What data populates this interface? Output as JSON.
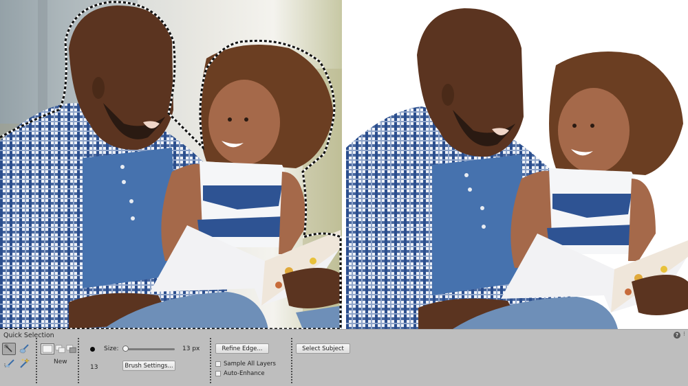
{
  "app": {
    "panel": "Tool Options"
  },
  "canvas": {
    "left_image": {
      "label": "Original photo with active selection (marching ants)",
      "selection_active": true
    },
    "right_image": {
      "label": "Selected subject on white background",
      "background": "#ffffff"
    }
  },
  "options_bar": {
    "tool_title": "Quick Selection",
    "tools": [
      {
        "name": "quick-selection",
        "icon": "quick-selection-icon",
        "active": true
      },
      {
        "name": "selection-brush",
        "icon": "selection-brush-icon",
        "active": false
      },
      {
        "name": "auto-selection",
        "icon": "auto-selection-icon",
        "active": false
      },
      {
        "name": "magic-wand",
        "icon": "magic-wand-icon",
        "active": false
      }
    ],
    "selection_modes": [
      {
        "name": "new",
        "icon": "new-selection-icon",
        "active": true
      },
      {
        "name": "add",
        "icon": "add-to-selection-icon",
        "active": false
      },
      {
        "name": "subtract",
        "icon": "subtract-from-selection-icon",
        "active": false
      }
    ],
    "mode_label": "New",
    "brush": {
      "preview_size": "13",
      "size_label": "Size:",
      "size_value": 13,
      "size_readout": "13 px",
      "size_fraction": 0.02,
      "settings_button": "Brush Settings..."
    },
    "refine_edge_button": "Refine Edge...",
    "sample_all_layers": {
      "label": "Sample All Layers",
      "checked": false
    },
    "auto_enhance": {
      "label": "Auto-Enhance",
      "checked": false
    },
    "select_subject_button": "Select Subject",
    "help_icon": "?",
    "panel_menu_icon": "⁝"
  },
  "colors": {
    "panel_bg": "#bebebe",
    "shirt_blue": "#2c4f8e",
    "tee_blue": "#4672ae",
    "skin_dark": "#5b3420",
    "hair_brown": "#6b3e22"
  }
}
